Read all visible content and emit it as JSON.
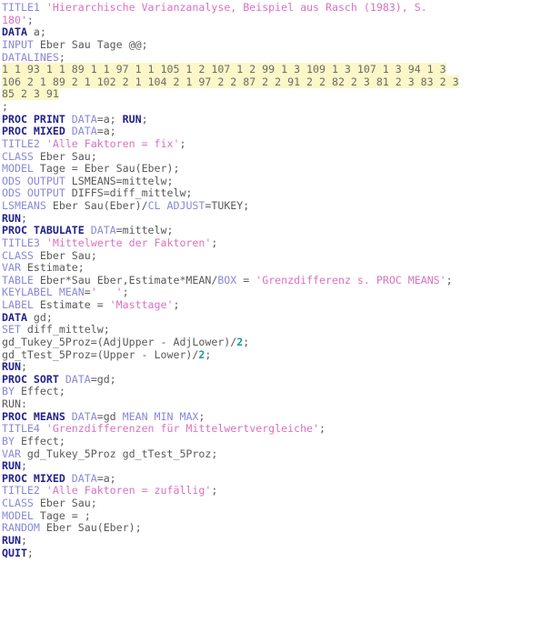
{
  "editor": {
    "language": "SAS",
    "background_color": "#ffffff",
    "datalines_highlight_color": "#fcf7c8",
    "colors": {
      "step_keyword": "#21218c",
      "statement_keyword": "#8888d8",
      "string_literal": "#d972c0",
      "identifier": "#595959",
      "number_literal": "#1a9a9a"
    }
  },
  "code": {
    "lines": [
      {
        "n": 1,
        "tokens": [
          {
            "t": "kw",
            "v": "TITLE1"
          },
          {
            "t": "plain",
            "v": " "
          },
          {
            "t": "str",
            "v": "'Hierarchische Varianzanalyse, Beispiel aus Rasch (1983), S."
          }
        ]
      },
      {
        "n": 2,
        "tokens": [
          {
            "t": "str",
            "v": "180'"
          },
          {
            "t": "plain",
            "v": ";"
          }
        ]
      },
      {
        "n": 3,
        "tokens": [
          {
            "t": "step",
            "v": "DATA"
          },
          {
            "t": "plain",
            "v": " a;"
          }
        ]
      },
      {
        "n": 4,
        "tokens": [
          {
            "t": "kw",
            "v": "INPUT"
          },
          {
            "t": "plain",
            "v": " Eber Sau Tage @@;"
          }
        ]
      },
      {
        "n": 5,
        "tokens": [
          {
            "t": "kw",
            "v": "DATALINES"
          },
          {
            "t": "plain",
            "v": ";"
          }
        ]
      },
      {
        "n": 6,
        "highlight": true,
        "tokens": [
          {
            "t": "data",
            "v": "1 1 93 1 1 89 1 1 97 1 1 105 1 2 107 1 2 99 1 3 109 1 3 107 1 3 94 1 3"
          }
        ]
      },
      {
        "n": 7,
        "highlight": true,
        "tokens": [
          {
            "t": "data",
            "v": "106 2 1 89 2 1 102 2 1 104 2 1 97 2 2 87 2 2 91 2 2 82 2 3 81 2 3 83 2 3"
          }
        ]
      },
      {
        "n": 8,
        "highlight": true,
        "tokens": [
          {
            "t": "data",
            "v": "85 2 3 91"
          }
        ]
      },
      {
        "n": 9,
        "tokens": [
          {
            "t": "plain",
            "v": ";"
          }
        ]
      },
      {
        "n": 10,
        "tokens": [
          {
            "t": "step",
            "v": "PROC PRINT"
          },
          {
            "t": "plain",
            "v": " "
          },
          {
            "t": "opt",
            "v": "DATA"
          },
          {
            "t": "plain",
            "v": "=a; "
          },
          {
            "t": "step",
            "v": "RUN"
          },
          {
            "t": "plain",
            "v": ";"
          }
        ]
      },
      {
        "n": 11,
        "tokens": [
          {
            "t": "step",
            "v": "PROC MIXED"
          },
          {
            "t": "plain",
            "v": " "
          },
          {
            "t": "opt",
            "v": "DATA"
          },
          {
            "t": "plain",
            "v": "=a;"
          }
        ]
      },
      {
        "n": 12,
        "tokens": [
          {
            "t": "kw",
            "v": "TITLE2"
          },
          {
            "t": "plain",
            "v": " "
          },
          {
            "t": "str",
            "v": "'Alle Faktoren = fix'"
          },
          {
            "t": "plain",
            "v": ";"
          }
        ]
      },
      {
        "n": 13,
        "tokens": [
          {
            "t": "kw",
            "v": "CLASS"
          },
          {
            "t": "plain",
            "v": " Eber Sau;"
          }
        ]
      },
      {
        "n": 14,
        "tokens": [
          {
            "t": "kw",
            "v": "MODEL"
          },
          {
            "t": "plain",
            "v": " Tage = Eber Sau(Eber);"
          }
        ]
      },
      {
        "n": 15,
        "tokens": [
          {
            "t": "kw",
            "v": "ODS OUTPUT"
          },
          {
            "t": "plain",
            "v": " LSMEANS=mittelw;"
          }
        ]
      },
      {
        "n": 16,
        "tokens": [
          {
            "t": "kw",
            "v": "ODS OUTPUT"
          },
          {
            "t": "plain",
            "v": " DIFFS=diff_mittelw;"
          }
        ]
      },
      {
        "n": 17,
        "tokens": [
          {
            "t": "kw",
            "v": "LSMEANS"
          },
          {
            "t": "plain",
            "v": " Eber Sau(Eber)/"
          },
          {
            "t": "opt",
            "v": "CL ADJUST"
          },
          {
            "t": "plain",
            "v": "=TUKEY;"
          }
        ]
      },
      {
        "n": 18,
        "tokens": [
          {
            "t": "step",
            "v": "RUN"
          },
          {
            "t": "plain",
            "v": ";"
          }
        ]
      },
      {
        "n": 19,
        "tokens": [
          {
            "t": "step",
            "v": "PROC TABULATE"
          },
          {
            "t": "plain",
            "v": " "
          },
          {
            "t": "opt",
            "v": "DATA"
          },
          {
            "t": "plain",
            "v": "=mittelw;"
          }
        ]
      },
      {
        "n": 20,
        "tokens": [
          {
            "t": "kw",
            "v": "TITLE3"
          },
          {
            "t": "plain",
            "v": " "
          },
          {
            "t": "str",
            "v": "'Mittelwerte der Faktoren'"
          },
          {
            "t": "plain",
            "v": ";"
          }
        ]
      },
      {
        "n": 21,
        "tokens": [
          {
            "t": "kw",
            "v": "CLASS"
          },
          {
            "t": "plain",
            "v": " Eber Sau;"
          }
        ]
      },
      {
        "n": 22,
        "tokens": [
          {
            "t": "kw",
            "v": "VAR"
          },
          {
            "t": "plain",
            "v": " Estimate;"
          }
        ]
      },
      {
        "n": 23,
        "tokens": [
          {
            "t": "kw",
            "v": "TABLE"
          },
          {
            "t": "plain",
            "v": " Eber*Sau Eber,Estimate*MEAN/"
          },
          {
            "t": "opt",
            "v": "BOX"
          },
          {
            "t": "plain",
            "v": " = "
          },
          {
            "t": "str",
            "v": "'Grenzdifferenz s. PROC MEANS'"
          },
          {
            "t": "plain",
            "v": ";"
          }
        ]
      },
      {
        "n": 24,
        "tokens": [
          {
            "t": "kw",
            "v": "KEYLABEL MEAN"
          },
          {
            "t": "plain",
            "v": "="
          },
          {
            "t": "str",
            "v": "'   '"
          },
          {
            "t": "plain",
            "v": ";"
          }
        ]
      },
      {
        "n": 25,
        "tokens": [
          {
            "t": "kw",
            "v": "LABEL"
          },
          {
            "t": "plain",
            "v": " Estimate = "
          },
          {
            "t": "str",
            "v": "'Masttage'"
          },
          {
            "t": "plain",
            "v": ";"
          }
        ]
      },
      {
        "n": 26,
        "tokens": [
          {
            "t": "step",
            "v": "DATA"
          },
          {
            "t": "plain",
            "v": " gd;"
          }
        ]
      },
      {
        "n": 27,
        "tokens": [
          {
            "t": "kw",
            "v": "SET"
          },
          {
            "t": "plain",
            "v": " diff_mittelw;"
          }
        ]
      },
      {
        "n": 28,
        "tokens": [
          {
            "t": "plain",
            "v": "gd_Tukey_5Proz=(AdjUpper - AdjLower)/"
          },
          {
            "t": "num",
            "v": "2"
          },
          {
            "t": "plain",
            "v": ";"
          }
        ]
      },
      {
        "n": 29,
        "tokens": [
          {
            "t": "plain",
            "v": "gd_tTest_5Proz=(Upper - Lower)/"
          },
          {
            "t": "num",
            "v": "2"
          },
          {
            "t": "plain",
            "v": ";"
          }
        ]
      },
      {
        "n": 30,
        "tokens": [
          {
            "t": "step",
            "v": "RUN"
          },
          {
            "t": "plain",
            "v": ";"
          }
        ]
      },
      {
        "n": 31,
        "tokens": [
          {
            "t": "step",
            "v": "PROC SORT"
          },
          {
            "t": "plain",
            "v": " "
          },
          {
            "t": "opt",
            "v": "DATA"
          },
          {
            "t": "plain",
            "v": "=gd;"
          }
        ]
      },
      {
        "n": 32,
        "tokens": [
          {
            "t": "kw",
            "v": "BY"
          },
          {
            "t": "plain",
            "v": " Effect;"
          }
        ]
      },
      {
        "n": 33,
        "tokens": [
          {
            "t": "plain",
            "v": "RUN:"
          }
        ]
      },
      {
        "n": 34,
        "tokens": [
          {
            "t": "step",
            "v": "PROC MEANS"
          },
          {
            "t": "plain",
            "v": " "
          },
          {
            "t": "opt",
            "v": "DATA"
          },
          {
            "t": "plain",
            "v": "=gd "
          },
          {
            "t": "opt",
            "v": "MEAN MIN MAX"
          },
          {
            "t": "plain",
            "v": ";"
          }
        ]
      },
      {
        "n": 35,
        "tokens": [
          {
            "t": "kw",
            "v": "TITLE4"
          },
          {
            "t": "plain",
            "v": " "
          },
          {
            "t": "str",
            "v": "'Grenzdifferenzen für Mittelwertvergleiche'"
          },
          {
            "t": "plain",
            "v": ";"
          }
        ]
      },
      {
        "n": 36,
        "tokens": [
          {
            "t": "kw",
            "v": "BY"
          },
          {
            "t": "plain",
            "v": " Effect;"
          }
        ]
      },
      {
        "n": 37,
        "tokens": [
          {
            "t": "kw",
            "v": "VAR"
          },
          {
            "t": "plain",
            "v": " gd_Tukey_5Proz gd_tTest_5Proz;"
          }
        ]
      },
      {
        "n": 38,
        "tokens": [
          {
            "t": "step",
            "v": "RUN"
          },
          {
            "t": "plain",
            "v": ";"
          }
        ]
      },
      {
        "n": 39,
        "tokens": [
          {
            "t": "step",
            "v": "PROC MIXED"
          },
          {
            "t": "plain",
            "v": " "
          },
          {
            "t": "opt",
            "v": "DATA"
          },
          {
            "t": "plain",
            "v": "=a;"
          }
        ]
      },
      {
        "n": 40,
        "tokens": [
          {
            "t": "kw",
            "v": "TITLE2"
          },
          {
            "t": "plain",
            "v": " "
          },
          {
            "t": "str",
            "v": "'Alle Faktoren = zufällig'"
          },
          {
            "t": "plain",
            "v": ";"
          }
        ]
      },
      {
        "n": 41,
        "tokens": [
          {
            "t": "kw",
            "v": "CLASS"
          },
          {
            "t": "plain",
            "v": " Eber Sau;"
          }
        ]
      },
      {
        "n": 42,
        "tokens": [
          {
            "t": "kw",
            "v": "MODEL"
          },
          {
            "t": "plain",
            "v": " Tage = ;"
          }
        ]
      },
      {
        "n": 43,
        "tokens": [
          {
            "t": "kw",
            "v": "RANDOM"
          },
          {
            "t": "plain",
            "v": " Eber Sau(Eber);"
          }
        ]
      },
      {
        "n": 44,
        "tokens": [
          {
            "t": "step",
            "v": "RUN"
          },
          {
            "t": "plain",
            "v": ";"
          }
        ]
      },
      {
        "n": 45,
        "tokens": [
          {
            "t": "step",
            "v": "QUIT"
          },
          {
            "t": "plain",
            "v": ";"
          }
        ]
      }
    ]
  }
}
